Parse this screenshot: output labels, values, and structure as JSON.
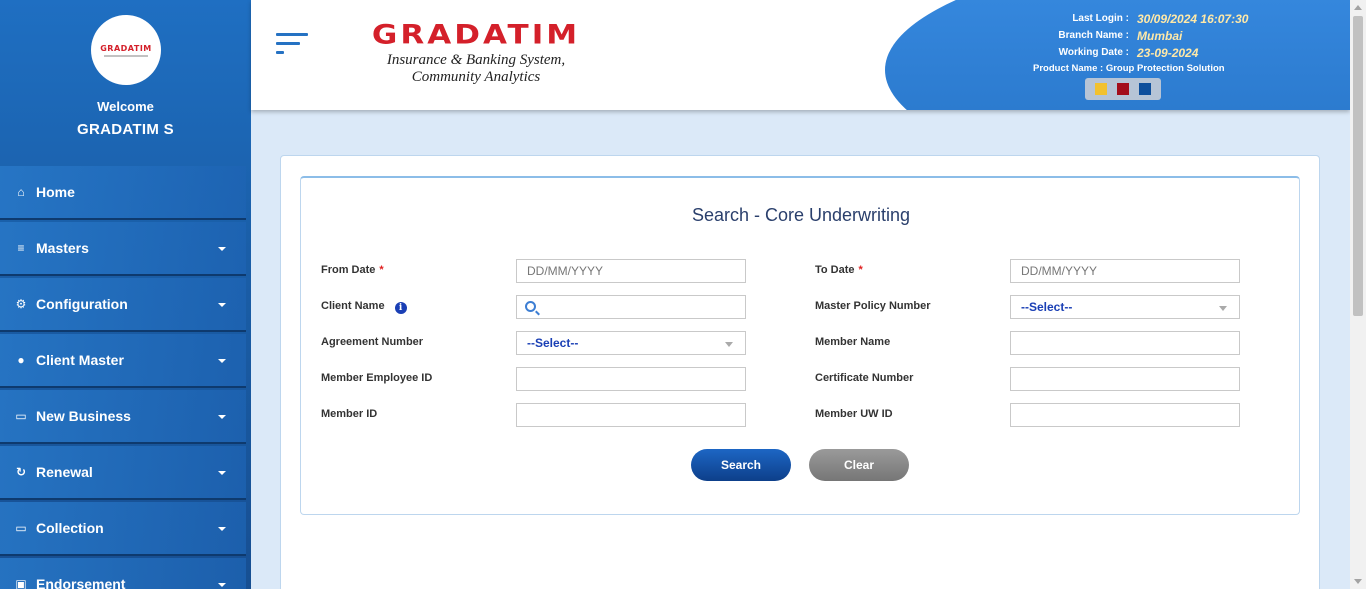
{
  "sidebar": {
    "logo_text": "GRADATIM",
    "welcome": "Welcome",
    "user_name": "GRADATIM S",
    "items": [
      {
        "label": "Home",
        "icon": "home-icon",
        "glyph": "⌂",
        "has_caret": false
      },
      {
        "label": "Masters",
        "icon": "database-icon",
        "glyph": "≡",
        "has_caret": true
      },
      {
        "label": "Configuration",
        "icon": "gears-icon",
        "glyph": "⚙",
        "has_caret": true
      },
      {
        "label": "Client Master",
        "icon": "user-icon",
        "glyph": "●",
        "has_caret": true
      },
      {
        "label": "New Business",
        "icon": "monitor-icon",
        "glyph": "▭",
        "has_caret": true
      },
      {
        "label": "Renewal",
        "icon": "refresh-icon",
        "glyph": "↻",
        "has_caret": true
      },
      {
        "label": "Collection",
        "icon": "monitor-icon",
        "glyph": "▭",
        "has_caret": true
      },
      {
        "label": "Endorsement",
        "icon": "briefcase-icon",
        "glyph": "▣",
        "has_caret": true
      }
    ]
  },
  "header": {
    "logo_title": "GRADATIM",
    "logo_subtitle": "Insurance & Banking System, Community Analytics",
    "last_login_label": "Last Login :",
    "last_login_value": "30/09/2024 16:07:30",
    "branch_label": "Branch Name :",
    "branch_value": "Mumbai",
    "working_date_label": "Working Date :",
    "working_date_value": "23-09-2024",
    "product_label": "Product Name : Group Protection Solution",
    "theme_colors": [
      "#f2c12e",
      "#a30d1b",
      "#0e4f9c"
    ]
  },
  "form": {
    "title": "Search - Core Underwriting",
    "fields": {
      "from_date": {
        "label": "From Date",
        "required": "*",
        "placeholder": "DD/MM/YYYY"
      },
      "to_date": {
        "label": "To Date",
        "required": "*",
        "placeholder": "DD/MM/YYYY"
      },
      "client_name": {
        "label": "Client Name",
        "value": ""
      },
      "master_policy": {
        "label": "Master Policy Number",
        "selected": "--Select--"
      },
      "agreement_number": {
        "label": "Agreement Number",
        "selected": "--Select--"
      },
      "member_name": {
        "label": "Member Name",
        "value": ""
      },
      "member_employee_id": {
        "label": "Member Employee ID",
        "value": ""
      },
      "certificate_number": {
        "label": "Certificate Number",
        "value": ""
      },
      "member_id": {
        "label": "Member ID",
        "value": ""
      },
      "member_uw_id": {
        "label": "Member UW ID",
        "value": ""
      }
    },
    "buttons": {
      "search": "Search",
      "clear": "Clear"
    }
  }
}
